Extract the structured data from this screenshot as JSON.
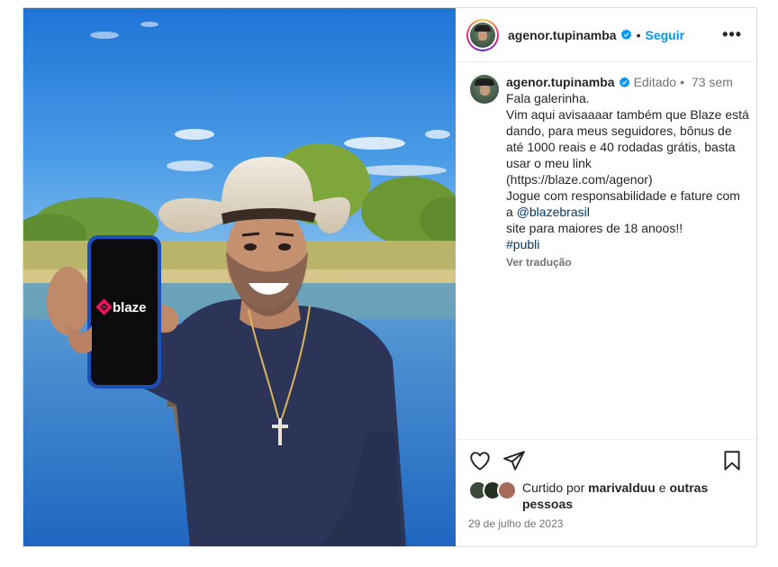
{
  "header": {
    "username": "agenor.tupinamba",
    "dot": "•",
    "follow_label": "Seguir",
    "more_label": "•••"
  },
  "caption": {
    "username": "agenor.tupinamba",
    "edited": "Editado",
    "dot": "•",
    "time": "73 sem",
    "lines": [
      "Fala galerinha.",
      "Vim aqui avisaaaar também que Blaze está",
      "dando, para meus seguidores, bônus de",
      "até 1000 reais e 40 rodadas grátis, basta",
      "usar o meu link",
      "(https://blaze.com/agenor)",
      "Jogue com responsabilidade e fature com"
    ],
    "mention_prefix": "a ",
    "mention": "@blazebrasil",
    "line_after_mention": "site para maiores de 18 anoos!!",
    "hashtag": "#publi",
    "translate_label": "Ver tradução"
  },
  "media": {
    "phone_brand": "blaze"
  },
  "likes": {
    "prefix": "Curtido por ",
    "user": "marivalduu",
    "middle": " e ",
    "others": "outras pessoas"
  },
  "date": "29 de julho de 2023",
  "colors": {
    "follow": "#0095f6",
    "verified": "#0095f6",
    "link": "#00376b",
    "muted": "#737373",
    "brand_accent": "#e8175d"
  },
  "icons": [
    "verified-badge-icon",
    "more-options-icon",
    "heart-icon",
    "share-icon",
    "bookmark-icon",
    "blaze-logo-icon"
  ]
}
